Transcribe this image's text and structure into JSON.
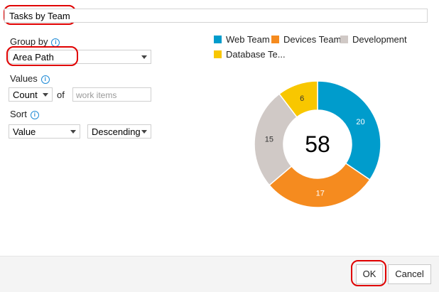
{
  "title_field": {
    "value": "Tasks by Team"
  },
  "group_by": {
    "label": "Group by",
    "selected": "Area Path"
  },
  "values": {
    "label": "Values",
    "aggregate": "Count",
    "of_text": "of",
    "field_placeholder": "work items"
  },
  "sort": {
    "label": "Sort",
    "field": "Value",
    "direction": "Descending"
  },
  "chart_data": {
    "type": "pie",
    "variant": "donut",
    "total_label": "58",
    "categories": [
      "Web Team",
      "Devices Team",
      "Development",
      "Database Te..."
    ],
    "values": [
      20,
      17,
      15,
      6
    ],
    "colors": [
      "#009ccc",
      "#f58b1f",
      "#d0c9c6",
      "#f8c700"
    ],
    "legend_position": "top"
  },
  "buttons": {
    "ok": "OK",
    "cancel": "Cancel"
  }
}
